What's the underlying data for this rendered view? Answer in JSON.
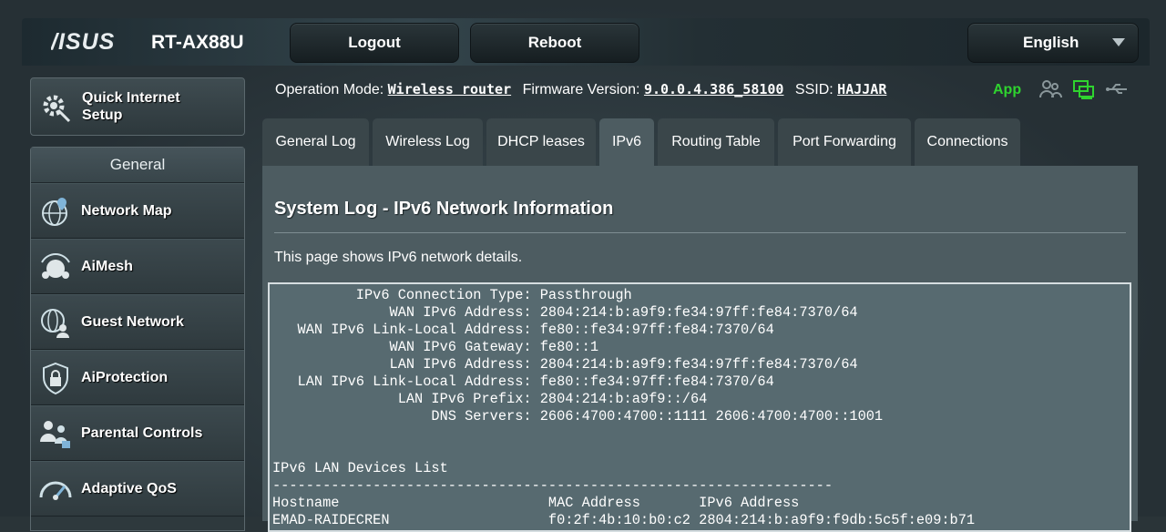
{
  "header": {
    "logo": "/ISUS",
    "model": "RT-AX88U",
    "logout_label": "Logout",
    "reboot_label": "Reboot",
    "language": "English"
  },
  "sidebar": {
    "quick_setup_label": "Quick Internet Setup",
    "section_title": "General",
    "items": [
      {
        "label": "Network Map",
        "icon": "globe-pin-icon"
      },
      {
        "label": "AiMesh",
        "icon": "mesh-icon"
      },
      {
        "label": "Guest Network",
        "icon": "guest-globe-icon"
      },
      {
        "label": "AiProtection",
        "icon": "lock-shield-icon"
      },
      {
        "label": "Parental Controls",
        "icon": "family-icon"
      },
      {
        "label": "Adaptive QoS",
        "icon": "gauge-icon"
      }
    ]
  },
  "status": {
    "op_mode_label": "Operation Mode:",
    "op_mode_value": "Wireless router",
    "firmware_label": "Firmware Version:",
    "firmware_value": "9.0.0.4.386_58100",
    "ssid_label": "SSID:",
    "ssid_value": "HAJJAR",
    "app_label": "App"
  },
  "tabs": [
    {
      "label": "General Log",
      "active": false
    },
    {
      "label": "Wireless Log",
      "active": false
    },
    {
      "label": "DHCP leases",
      "active": false
    },
    {
      "label": "IPv6",
      "active": true
    },
    {
      "label": "Routing Table",
      "active": false
    },
    {
      "label": "Port Forwarding",
      "active": false
    },
    {
      "label": "Connections",
      "active": false
    }
  ],
  "content": {
    "title": "System Log - IPv6 Network Information",
    "description": "This page shows IPv6 network details.",
    "log_lines": [
      "          IPv6 Connection Type: Passthrough",
      "              WAN IPv6 Address: 2804:214:b:a9f9:fe34:97ff:fe84:7370/64",
      "   WAN IPv6 Link-Local Address: fe80::fe34:97ff:fe84:7370/64",
      "              WAN IPv6 Gateway: fe80::1",
      "              LAN IPv6 Address: 2804:214:b:a9f9:fe34:97ff:fe84:7370/64",
      "   LAN IPv6 Link-Local Address: fe80::fe34:97ff:fe84:7370/64",
      "               LAN IPv6 Prefix: 2804:214:b:a9f9::/64",
      "                   DNS Servers: 2606:4700:4700::1111 2606:4700:4700::1001",
      "",
      "",
      "IPv6 LAN Devices List",
      "-------------------------------------------------------------------",
      "Hostname                         MAC Address       IPv6 Address",
      "EMAD-RAIDECREN                   f0:2f:4b:10:b0:c2 2804:214:b:a9f9:f9db:5c5f:e09:b71"
    ]
  }
}
